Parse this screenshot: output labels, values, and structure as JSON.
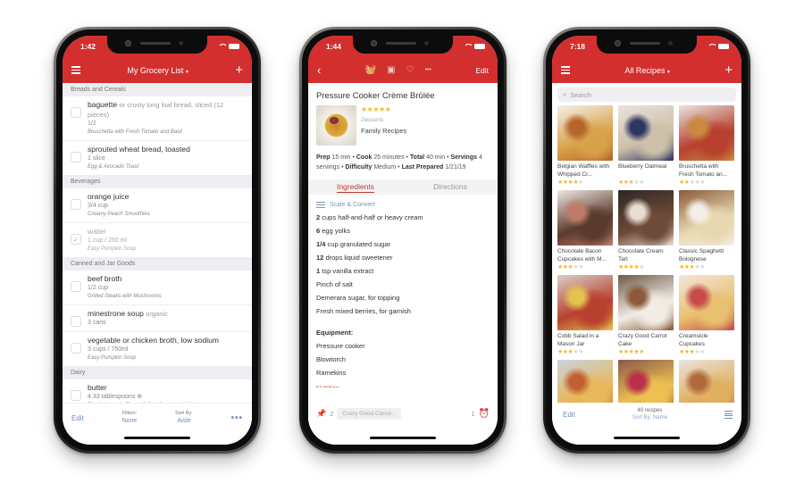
{
  "phones": [
    {
      "status_time": "1:42",
      "title": "My Grocery List",
      "sections": [
        {
          "name": "Breads and Cereals",
          "items": [
            {
              "name": "baguette",
              "note": "or crusty long loaf bread, sliced (12 pieces)",
              "qty": "1/2",
              "recipe": "Bruschetta with Fresh Tomato and Basil",
              "checked": false
            },
            {
              "name": "sprouted wheat bread, toasted",
              "note": "",
              "qty": "1 slice",
              "recipe": "Egg & Avocado Toast",
              "checked": false
            }
          ]
        },
        {
          "name": "Beverages",
          "items": [
            {
              "name": "orange juice",
              "note": "",
              "qty": "3/4 cup",
              "recipe": "Creamy Peach Smoothies",
              "checked": false
            },
            {
              "name": "water",
              "note": "",
              "qty": "1 cup / 250 ml",
              "recipe": "Easy Pumpkin Soup",
              "checked": true
            }
          ]
        },
        {
          "name": "Canned and Jar Goods",
          "items": [
            {
              "name": "beef broth",
              "note": "",
              "qty": "1/2 cup",
              "recipe": "Grilled Steaks with Mushrooms",
              "checked": false
            },
            {
              "name": "minestrone soup",
              "note": "organic",
              "qty": "3 cans",
              "recipe": "",
              "checked": false
            },
            {
              "name": "vegetable or chicken broth, low sodium",
              "note": "",
              "qty": "3 cups / 750ml",
              "recipe": "Easy Pumpkin Soup",
              "checked": false
            }
          ]
        },
        {
          "name": "Dairy",
          "items": [
            {
              "name": "butter",
              "note": "",
              "qty": "4.33 tablespoons ⊕",
              "recipe": "Egg & Avocado Toast, Grilled Steaks with Mushrooms",
              "checked": false
            }
          ]
        }
      ],
      "bottom": {
        "edit": "Edit",
        "filters_label": "Filters:",
        "filters_value": "None",
        "sort_label": "Sort By:",
        "sort_value": "Aisle",
        "more": "•••"
      }
    },
    {
      "status_time": "1:44",
      "edit": "Edit",
      "more": "•••",
      "recipe_title": "Pressure Cooker Crème Brûlée",
      "rating": 5,
      "category": "Desserts",
      "collection": "Family Recipes",
      "info": {
        "prep_label": "Prep",
        "prep": "15 min",
        "cook_label": "Cook",
        "cook": "25 minutes",
        "total_label": "Total",
        "total": "40 min",
        "servings_label": "Servings",
        "servings": "4 servings",
        "difficulty_label": "Difficulty",
        "difficulty": "Medium",
        "last_label": "Last Prepared",
        "last": "1/21/19"
      },
      "tabs": [
        "Ingredients",
        "Directions"
      ],
      "active_tab": "Ingredients",
      "scale_convert": "Scale & Convert",
      "ingredients": [
        {
          "amount": "2",
          "text": "cups half-and-half or heavy cream"
        },
        {
          "amount": "6",
          "text": "egg yolks"
        },
        {
          "amount": "1/4",
          "text": "cup granulated sugar"
        },
        {
          "amount": "12",
          "text": "drops liquid sweetener"
        },
        {
          "amount": "1",
          "text": "tsp vanilla extract"
        },
        {
          "amount": "",
          "text": "Pinch of salt"
        },
        {
          "amount": "",
          "text": "Demerara sugar, for topping"
        },
        {
          "amount": "",
          "text": "Fresh mixed berries, for garnish"
        }
      ],
      "equipment_heading": "Equipment:",
      "equipment": [
        "Pressure cooker",
        "Blowtorch",
        "Ramekins"
      ],
      "nutrition_heading": "Nutrition",
      "bottom": {
        "pinned_count": "2",
        "pinned_chip": "Crazy Good Carrot...",
        "timer_count": "1"
      }
    },
    {
      "status_time": "7:18",
      "title": "All Recipes",
      "search_placeholder": "Search",
      "recipes": [
        {
          "name": "Belgian Waffles with Whipped Cr...",
          "rating": 4,
          "colors": [
            "#f3efe8",
            "#d9a24a",
            "#b5652a"
          ]
        },
        {
          "name": "Blueberry Oatmeal",
          "rating": 3,
          "colors": [
            "#e8e3dc",
            "#cdbfa8",
            "#2c3563"
          ]
        },
        {
          "name": "Bruschetta with Fresh Tomato an...",
          "rating": 2,
          "colors": [
            "#e9e4df",
            "#b8402e",
            "#c98a3e"
          ]
        },
        {
          "name": "Chocolate Bacon Cupcakes with M...",
          "rating": 3,
          "colors": [
            "#efe8e2",
            "#5a3a2c",
            "#c07c6a"
          ]
        },
        {
          "name": "Chocolate Cream Tart",
          "rating": 4,
          "colors": [
            "#2e2724",
            "#6e4a38",
            "#e9ddd2"
          ]
        },
        {
          "name": "Classic Spaghetti Bolognese",
          "rating": 3,
          "colors": [
            "#8a5a3a",
            "#e8d8b0",
            "#f3efe6"
          ]
        },
        {
          "name": "Cobb Salad in a Mason Jar",
          "rating": 3,
          "colors": [
            "#d8d0c8",
            "#b8402e",
            "#e5c24e"
          ]
        },
        {
          "name": "Crazy Good Carrot Cake",
          "rating": 5,
          "colors": [
            "#6e5a48",
            "#f2ece4",
            "#8a5a3a"
          ]
        },
        {
          "name": "Creamsicle Cupcakes",
          "rating": 3,
          "colors": [
            "#f4e6dc",
            "#e8c070",
            "#c84a4a"
          ]
        },
        {
          "name": "",
          "rating": 0,
          "colors": [
            "#c8d4e0",
            "#e8b85a",
            "#c06030"
          ]
        },
        {
          "name": "",
          "rating": 0,
          "colors": [
            "#8a5a4a",
            "#eec050",
            "#b8304a"
          ]
        },
        {
          "name": "",
          "rating": 0,
          "colors": [
            "#e8e4e0",
            "#e0b060",
            "#b06a3a"
          ]
        }
      ],
      "bottom": {
        "edit": "Edit",
        "count": "40 recipes",
        "sort": "Sort By: Name"
      }
    }
  ],
  "colors": {
    "brand_red": "#d32f2f",
    "link_blue": "#6d8cbf",
    "star_gold": "#f5b82e"
  }
}
